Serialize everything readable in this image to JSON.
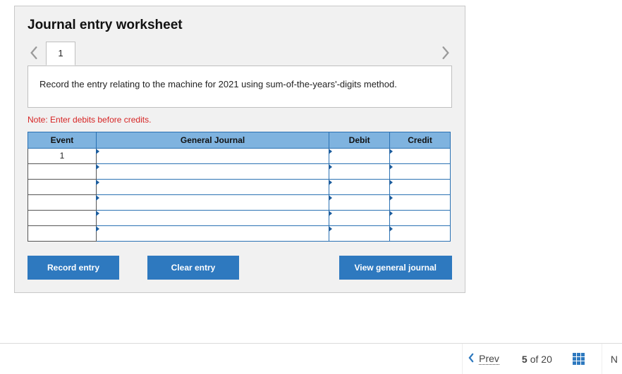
{
  "worksheet": {
    "title": "Journal entry worksheet",
    "active_tab_label": "1",
    "instruction": "Record the entry relating to the machine for 2021 using sum-of-the-years'-digits method.",
    "note": "Note: Enter debits before credits.",
    "columns": {
      "event": "Event",
      "general_journal": "General Journal",
      "debit": "Debit",
      "credit": "Credit"
    },
    "rows": [
      {
        "event": "1",
        "journal": "",
        "debit": "",
        "credit": ""
      },
      {
        "event": "",
        "journal": "",
        "debit": "",
        "credit": ""
      },
      {
        "event": "",
        "journal": "",
        "debit": "",
        "credit": ""
      },
      {
        "event": "",
        "journal": "",
        "debit": "",
        "credit": ""
      },
      {
        "event": "",
        "journal": "",
        "debit": "",
        "credit": ""
      },
      {
        "event": "",
        "journal": "",
        "debit": "",
        "credit": ""
      }
    ],
    "buttons": {
      "record": "Record entry",
      "clear": "Clear entry",
      "view": "View general journal"
    }
  },
  "footer": {
    "prev_label": "Prev",
    "current": "5",
    "of_word": "of",
    "total": "20",
    "next_stub": "N"
  }
}
